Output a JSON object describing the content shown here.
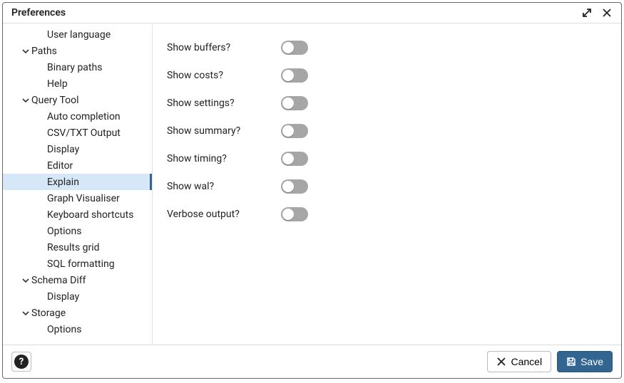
{
  "window": {
    "title": "Preferences"
  },
  "sidebar": {
    "items": [
      {
        "label": "User language",
        "kind": "leaf",
        "indent": 2
      },
      {
        "label": "Paths",
        "kind": "parent",
        "indent": 1
      },
      {
        "label": "Binary paths",
        "kind": "leaf",
        "indent": 2
      },
      {
        "label": "Help",
        "kind": "leaf",
        "indent": 2
      },
      {
        "label": "Query Tool",
        "kind": "parent",
        "indent": 1
      },
      {
        "label": "Auto completion",
        "kind": "leaf",
        "indent": 2
      },
      {
        "label": "CSV/TXT Output",
        "kind": "leaf",
        "indent": 2
      },
      {
        "label": "Display",
        "kind": "leaf",
        "indent": 2
      },
      {
        "label": "Editor",
        "kind": "leaf",
        "indent": 2
      },
      {
        "label": "Explain",
        "kind": "leaf",
        "indent": 2,
        "selected": true
      },
      {
        "label": "Graph Visualiser",
        "kind": "leaf",
        "indent": 2
      },
      {
        "label": "Keyboard shortcuts",
        "kind": "leaf",
        "indent": 2
      },
      {
        "label": "Options",
        "kind": "leaf",
        "indent": 2
      },
      {
        "label": "Results grid",
        "kind": "leaf",
        "indent": 2
      },
      {
        "label": "SQL formatting",
        "kind": "leaf",
        "indent": 2
      },
      {
        "label": "Schema Diff",
        "kind": "parent",
        "indent": 1
      },
      {
        "label": "Display",
        "kind": "leaf",
        "indent": 2
      },
      {
        "label": "Storage",
        "kind": "parent",
        "indent": 1
      },
      {
        "label": "Options",
        "kind": "leaf",
        "indent": 2
      }
    ]
  },
  "content": {
    "settings": [
      {
        "label": "Show buffers?",
        "state": "off"
      },
      {
        "label": "Show costs?",
        "state": "off"
      },
      {
        "label": "Show settings?",
        "state": "off"
      },
      {
        "label": "Show summary?",
        "state": "off"
      },
      {
        "label": "Show timing?",
        "state": "off"
      },
      {
        "label": "Show wal?",
        "state": "off"
      },
      {
        "label": "Verbose output?",
        "state": "off"
      }
    ]
  },
  "footer": {
    "help_tooltip": "?",
    "cancel_label": "Cancel",
    "save_label": "Save"
  }
}
